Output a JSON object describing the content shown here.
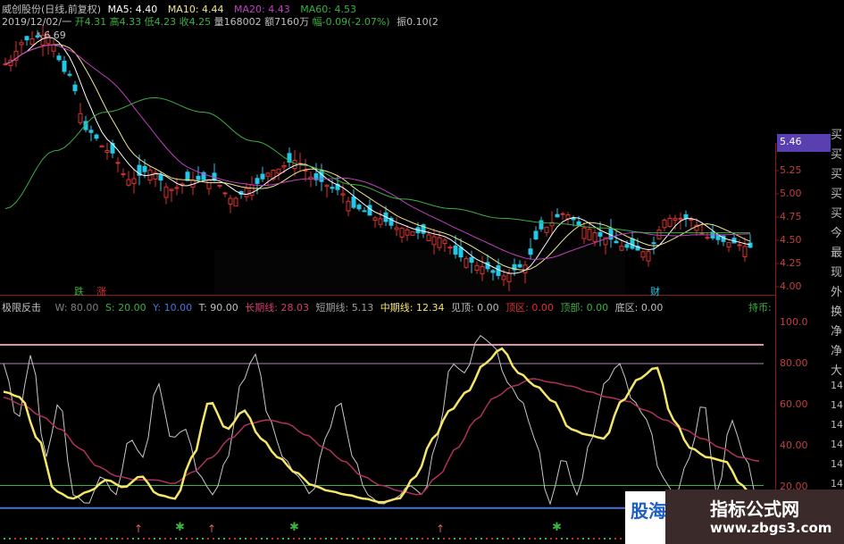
{
  "header": {
    "title": "威创股份(日线,前复权)",
    "ma5": "MA5: 4.40",
    "ma10": "MA10: 4.44",
    "ma20": "MA20: 4.43",
    "ma60": "MA60: 4.53"
  },
  "info": {
    "date": "2019/12/02/一",
    "open": "开4.31",
    "high": "高4.33",
    "low": "低4.23",
    "close": "收4.25",
    "volume": "量168002",
    "amount": "额7160万",
    "change": "幅-0.09(-2.07%)",
    "amplitude": "振0.10(2"
  },
  "price_marker": {
    "peak": "6.69",
    "current": "5.46"
  },
  "price_axis": [
    "5.25",
    "5.00",
    "4.75",
    "4.50",
    "4.25",
    "4.00"
  ],
  "signal_labels": {
    "die": "跌",
    "zhang": "涨",
    "cai": "财"
  },
  "indicator": {
    "name": "极限反击",
    "w": "W: 80.00",
    "s": "S: 20.00",
    "y": "Y: 10.00",
    "t": "T: 90.00",
    "long_label": "长期线:",
    "long_val": "28.03",
    "short_label": "短期线:",
    "short_val": "5.13",
    "mid_label": "中期线:",
    "mid_val": "12.34",
    "top_label": "见顶:",
    "top_val": "0.00",
    "zone_label": "顶区:",
    "zone_val": "0.00",
    "peak_label": "顶部:",
    "peak_val": "0.00",
    "bottom_label": "底区:",
    "bottom_val": "0.00",
    "hold": "持币:"
  },
  "indicator_axis": [
    "100.0",
    "80.00",
    "60.00",
    "40.00",
    "20.00"
  ],
  "side_chars": [
    "买",
    "买",
    "买",
    "买",
    "买",
    "今",
    "最",
    "现",
    "外",
    "换",
    "净",
    "净",
    "大"
  ],
  "side_small": [
    "14",
    "14",
    "14",
    "14",
    "14",
    "14",
    "14"
  ],
  "watermark": {
    "left": "股海",
    "right": "指标公式网",
    "url": "www.zbgs3.com"
  },
  "colors": {
    "up": "#e03030",
    "down": "#22c8e8",
    "ma5": "#ffffff",
    "ma10": "#f0e68c",
    "ma20": "#c040c0",
    "ma60": "#3cb043",
    "short": "#c8c8c8",
    "mid": "#f5e66a",
    "long": "#b03060"
  }
}
